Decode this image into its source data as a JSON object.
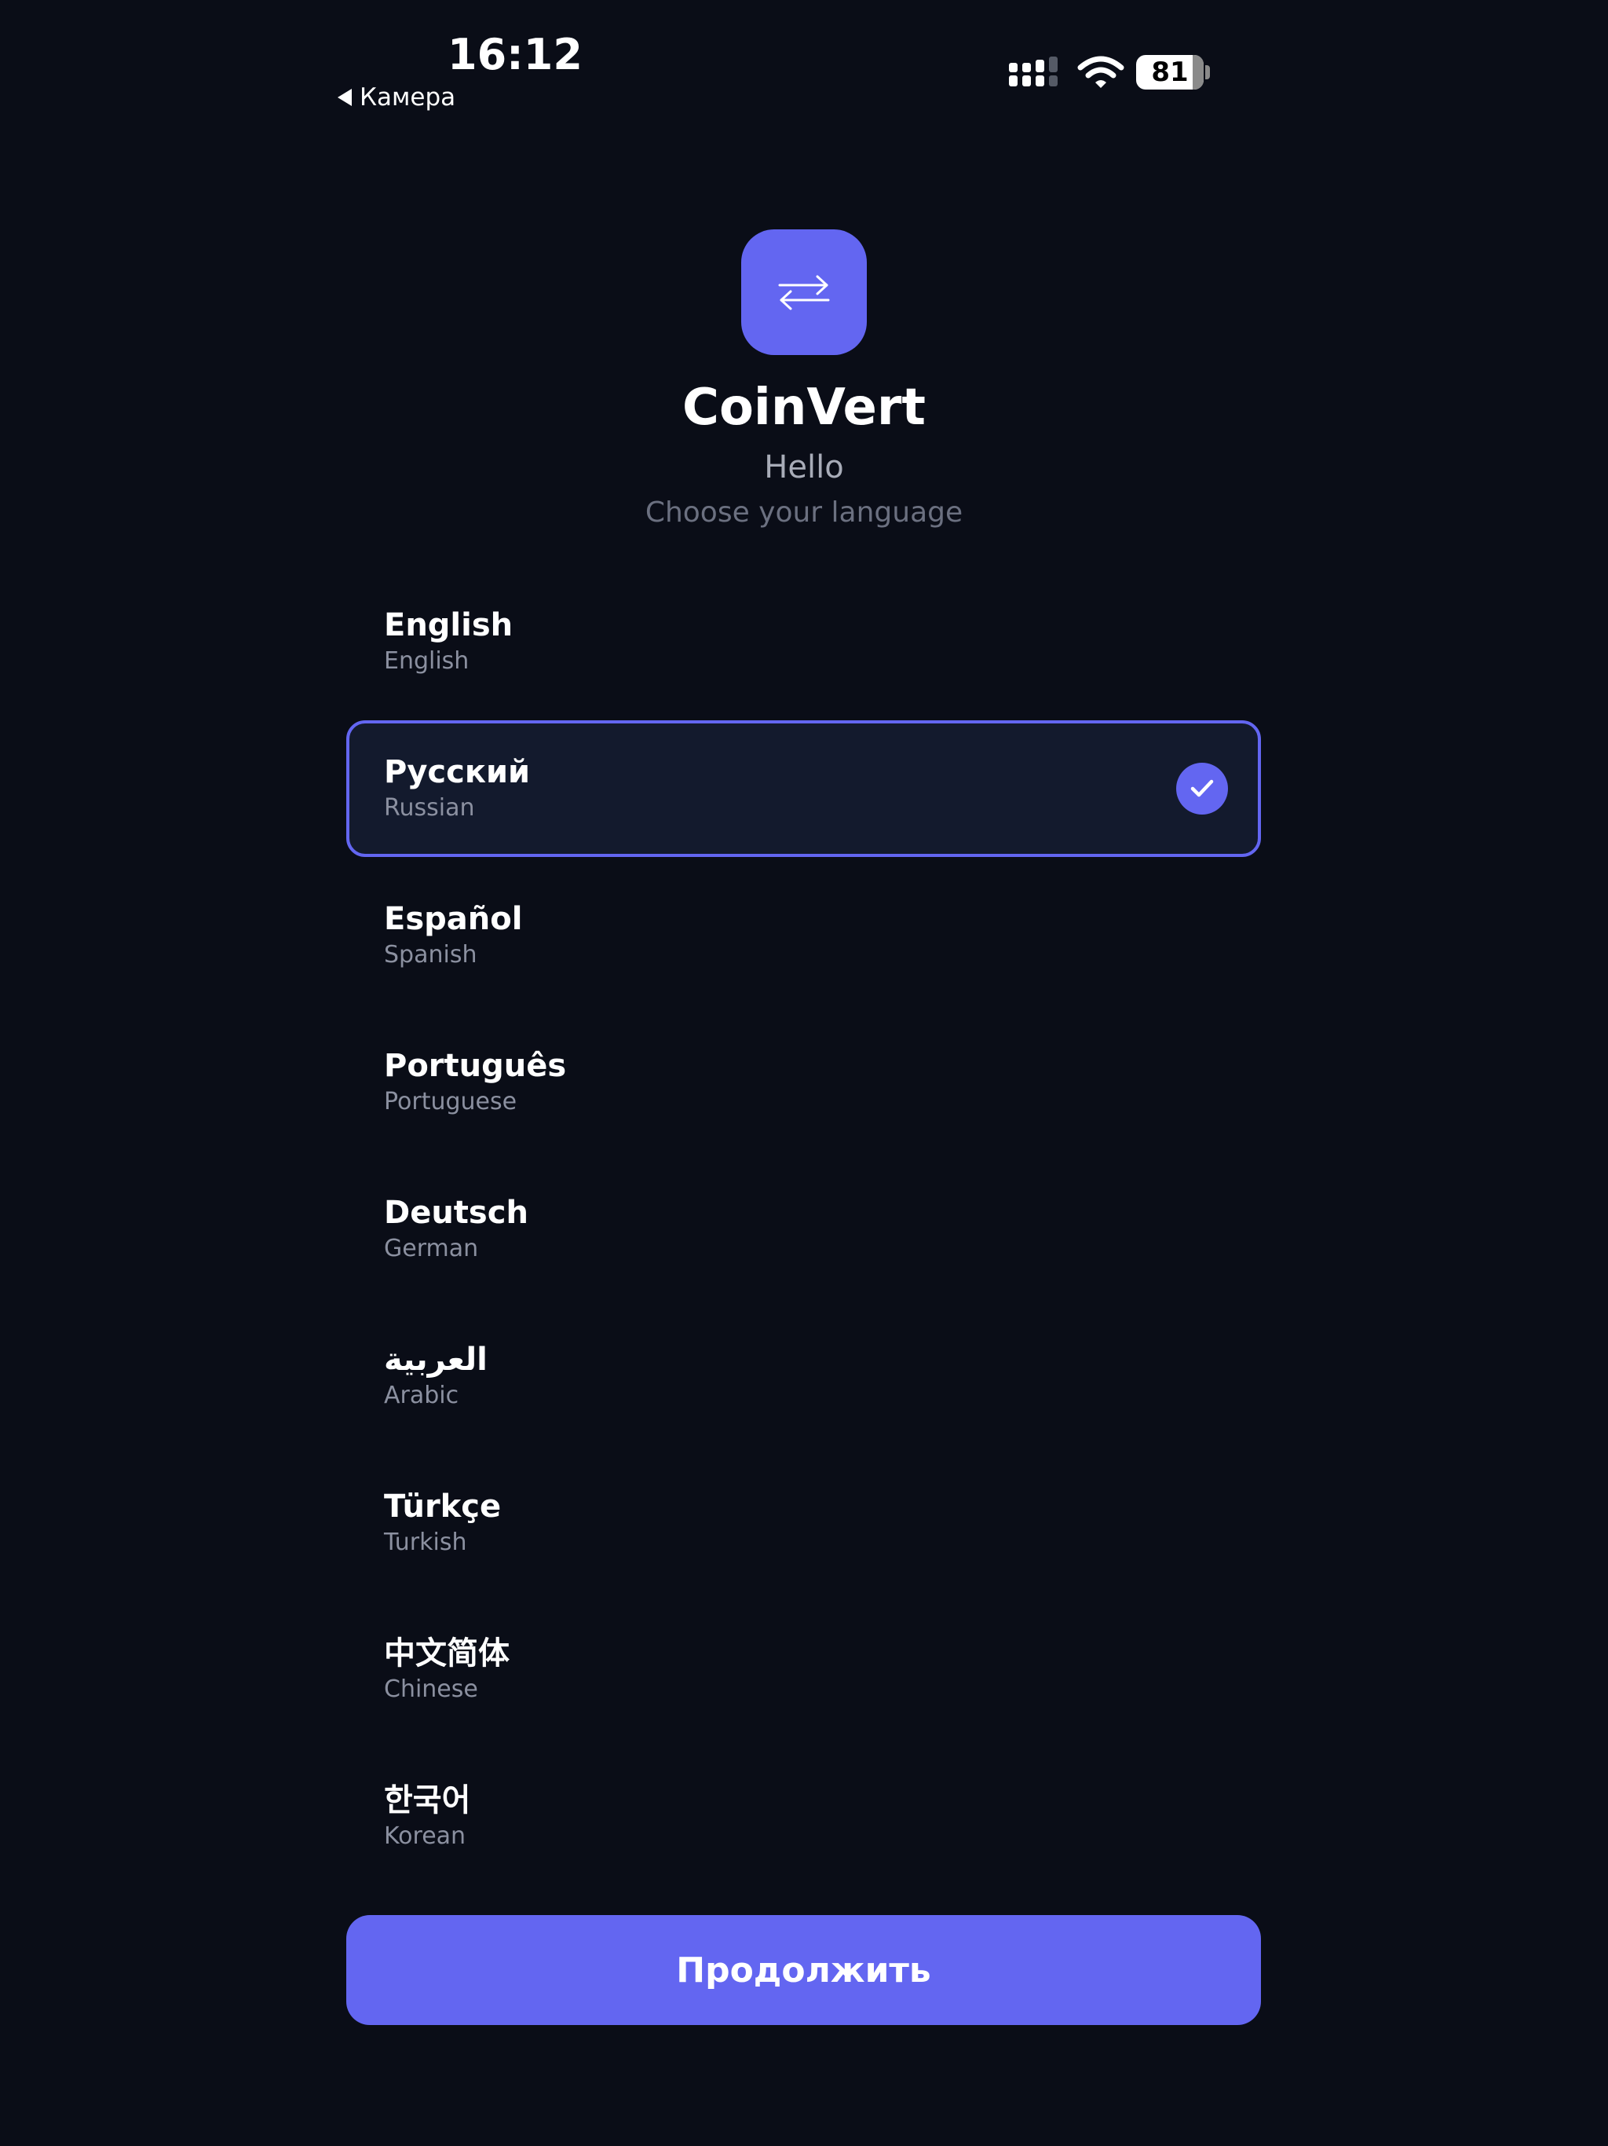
{
  "status_bar": {
    "time": "16:12",
    "back_label": "Камера",
    "battery_level": "81"
  },
  "header": {
    "app_name": "CoinVert",
    "greeting": "Hello",
    "subtitle": "Choose your language",
    "icon": "swap-arrows-icon"
  },
  "languages": [
    {
      "native": "English",
      "english": "English",
      "selected": false
    },
    {
      "native": "Русский",
      "english": "Russian",
      "selected": true
    },
    {
      "native": "Español",
      "english": "Spanish",
      "selected": false
    },
    {
      "native": "Português",
      "english": "Portuguese",
      "selected": false
    },
    {
      "native": "Deutsch",
      "english": "German",
      "selected": false
    },
    {
      "native": "العربية",
      "english": "Arabic",
      "selected": false
    },
    {
      "native": "Türkçe",
      "english": "Turkish",
      "selected": false
    },
    {
      "native": "中文简体",
      "english": "Chinese",
      "selected": false
    },
    {
      "native": "한국어",
      "english": "Korean",
      "selected": false
    }
  ],
  "continue_label": "Продолжить",
  "colors": {
    "background": "#0a0d17",
    "accent": "#6366f1",
    "selected_bg": "#131a2d"
  }
}
